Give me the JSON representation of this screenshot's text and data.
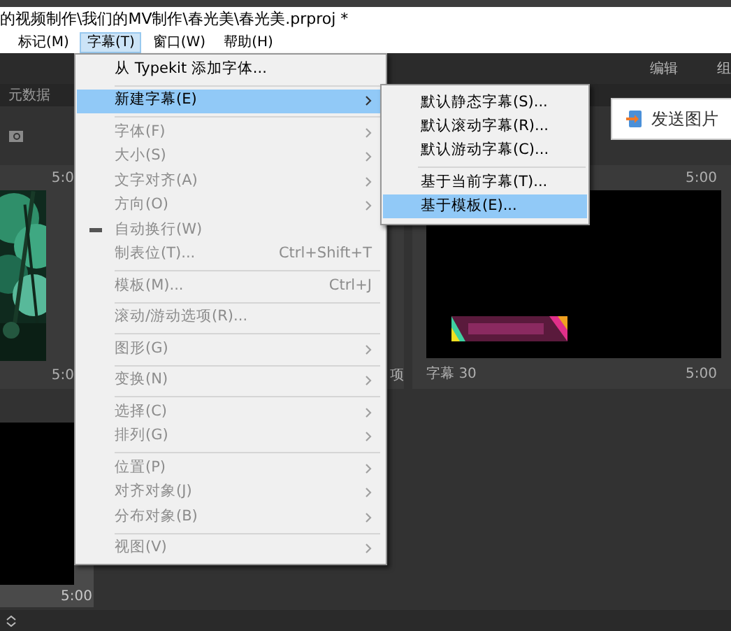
{
  "title_bar": {
    "path": "的视频制作\\我们的MV制作\\春光美\\春光美.prproj *"
  },
  "menu_bar": [
    {
      "label": "标记(M)",
      "selected": false
    },
    {
      "label": "字幕(T)",
      "selected": true
    },
    {
      "label": "窗口(W)",
      "selected": false
    },
    {
      "label": "帮助(H)",
      "selected": false
    }
  ],
  "workspace_tabs": [
    "编辑",
    "组"
  ],
  "panel_tab": "元数据",
  "clips": [
    {
      "duration": "5:0",
      "footer": "5:0"
    },
    {
      "footer": "项"
    },
    {
      "duration": "5:00",
      "name": "字幕",
      "frame": "30",
      "footer_duration": "5:00"
    }
  ],
  "clip_row2": {
    "duration": "5:00"
  },
  "caption_menu": [
    {
      "kind": "item",
      "label": "从 Typekit 添加字体...",
      "submenu": false,
      "disabled": false,
      "selected": false,
      "checked": false
    },
    {
      "kind": "separator"
    },
    {
      "kind": "item",
      "label": "新建字幕(E)",
      "submenu": true,
      "disabled": false,
      "selected": true,
      "checked": false
    },
    {
      "kind": "separator"
    },
    {
      "kind": "item",
      "label": "字体(F)",
      "submenu": true,
      "disabled": true,
      "selected": false,
      "checked": false
    },
    {
      "kind": "item",
      "label": "大小(S)",
      "submenu": true,
      "disabled": true,
      "selected": false,
      "checked": false
    },
    {
      "kind": "item",
      "label": "文字对齐(A)",
      "submenu": true,
      "disabled": true,
      "selected": false,
      "checked": false
    },
    {
      "kind": "item",
      "label": "方向(O)",
      "submenu": true,
      "disabled": true,
      "selected": false,
      "checked": false
    },
    {
      "kind": "item",
      "label": "自动换行(W)",
      "submenu": false,
      "disabled": true,
      "selected": false,
      "checked": true
    },
    {
      "kind": "item",
      "label": "制表位(T)...",
      "shortcut": "Ctrl+Shift+T",
      "submenu": false,
      "disabled": true,
      "selected": false,
      "checked": false
    },
    {
      "kind": "separator"
    },
    {
      "kind": "item",
      "label": "模板(M)...",
      "shortcut": "Ctrl+J",
      "submenu": false,
      "disabled": true,
      "selected": false,
      "checked": false
    },
    {
      "kind": "separator"
    },
    {
      "kind": "item",
      "label": "滚动/游动选项(R)...",
      "submenu": false,
      "disabled": true,
      "selected": false,
      "checked": false
    },
    {
      "kind": "separator"
    },
    {
      "kind": "item",
      "label": "图形(G)",
      "submenu": true,
      "disabled": true,
      "selected": false,
      "checked": false
    },
    {
      "kind": "separator"
    },
    {
      "kind": "item",
      "label": "变换(N)",
      "submenu": true,
      "disabled": true,
      "selected": false,
      "checked": false
    },
    {
      "kind": "separator"
    },
    {
      "kind": "item",
      "label": "选择(C)",
      "submenu": true,
      "disabled": true,
      "selected": false,
      "checked": false
    },
    {
      "kind": "item",
      "label": "排列(G)",
      "submenu": true,
      "disabled": true,
      "selected": false,
      "checked": false
    },
    {
      "kind": "separator"
    },
    {
      "kind": "item",
      "label": "位置(P)",
      "submenu": true,
      "disabled": true,
      "selected": false,
      "checked": false
    },
    {
      "kind": "item",
      "label": "对齐对象(J)",
      "submenu": true,
      "disabled": true,
      "selected": false,
      "checked": false
    },
    {
      "kind": "item",
      "label": "分布对象(B)",
      "submenu": true,
      "disabled": true,
      "selected": false,
      "checked": false
    },
    {
      "kind": "separator"
    },
    {
      "kind": "item",
      "label": "视图(V)",
      "submenu": true,
      "disabled": true,
      "selected": false,
      "checked": false
    }
  ],
  "new_caption_submenu": [
    {
      "kind": "item",
      "label": "默认静态字幕(S)...",
      "selected": false
    },
    {
      "kind": "item",
      "label": "默认滚动字幕(R)...",
      "selected": false
    },
    {
      "kind": "item",
      "label": "默认游动字幕(C)...",
      "selected": false
    },
    {
      "kind": "separator"
    },
    {
      "kind": "item",
      "label": "基于当前字幕(T)...",
      "selected": false
    },
    {
      "kind": "item",
      "label": "基于模板(E)...",
      "selected": true
    }
  ],
  "popup": {
    "label": "发送图片"
  }
}
